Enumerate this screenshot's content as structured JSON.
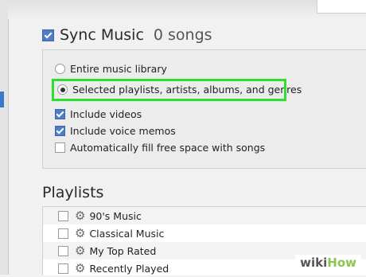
{
  "sync": {
    "title": "Sync Music",
    "count": "0 songs",
    "checked": true
  },
  "options": [
    {
      "label": "Entire music library",
      "selected": false
    },
    {
      "label": "Selected playlists, artists, albums, and genres",
      "selected": true
    }
  ],
  "checkboxes": [
    {
      "label": "Include videos",
      "checked": true
    },
    {
      "label": "Include voice memos",
      "checked": true
    },
    {
      "label": "Automatically fill free space with songs",
      "checked": false
    }
  ],
  "playlists": {
    "heading": "Playlists",
    "items": [
      {
        "label": "90's Music",
        "checked": false
      },
      {
        "label": "Classical Music",
        "checked": false
      },
      {
        "label": "My Top Rated",
        "checked": false
      },
      {
        "label": "Recently Played",
        "checked": false
      }
    ]
  },
  "watermark": {
    "part1": "wiki",
    "part2": "How"
  },
  "colors": {
    "highlight": "#2ee02e",
    "accent": "#4f7cc4"
  },
  "icons": {
    "playlist": "gear-icon"
  }
}
